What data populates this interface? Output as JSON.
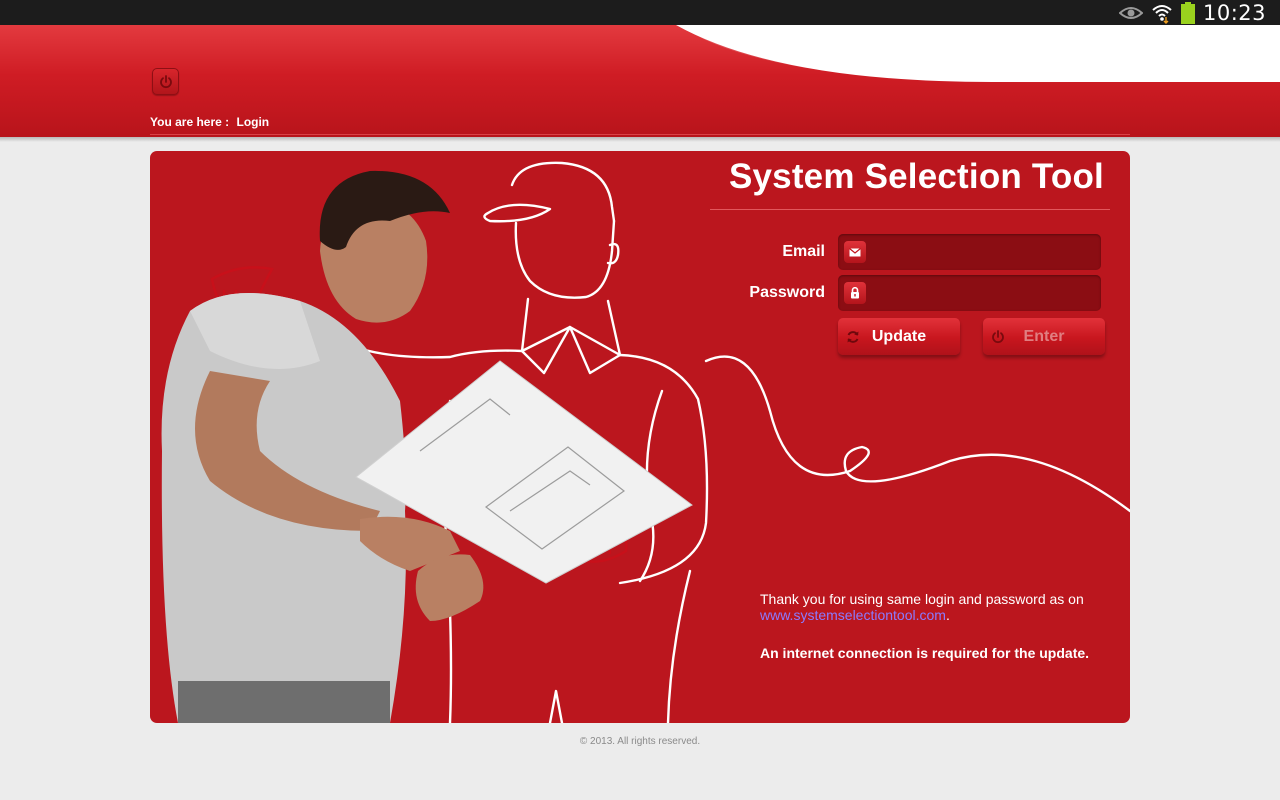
{
  "status_bar": {
    "time": "10:23",
    "icons": [
      "eye-icon",
      "wifi-icon",
      "battery-icon"
    ]
  },
  "header": {
    "power_icon": "power-icon",
    "breadcrumb_prefix": "You are here :",
    "breadcrumb_current": "Login"
  },
  "login": {
    "title": "System Selection Tool",
    "email_label": "Email",
    "email_value": "",
    "email_icon": "envelope-icon",
    "password_label": "Password",
    "password_value": "",
    "password_icon": "lock-icon",
    "update_label": "Update",
    "update_icon": "refresh-icon",
    "enter_label": "Enter",
    "enter_icon": "power-icon"
  },
  "info": {
    "text_before_link": "Thank you for using same login and password as on ",
    "link_text": "www.systemselectiontool.com",
    "text_after_link": ".",
    "note": "An internet connection is required for the update."
  },
  "footer": {
    "copyright": "© 2013. All rights reserved."
  },
  "colors": {
    "brand_red": "#bb161e",
    "header_red": "#cf1c24",
    "field_dark_red": "#8b0d13",
    "link": "#8a7bff",
    "background": "#ececec"
  }
}
